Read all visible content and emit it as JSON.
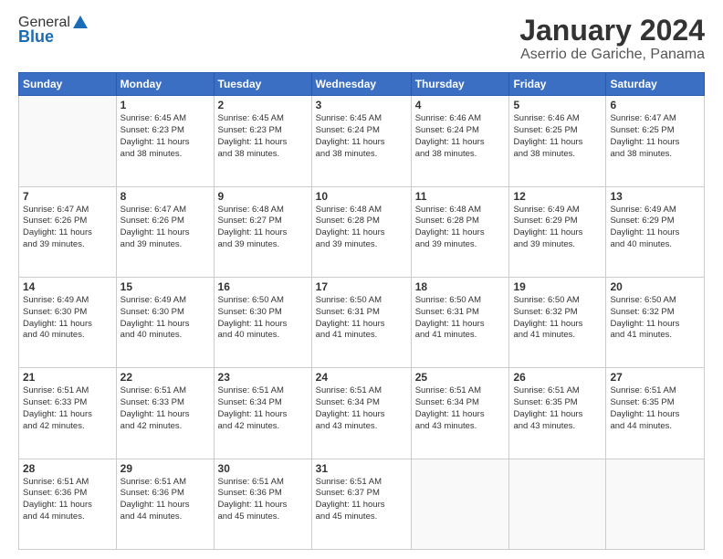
{
  "logo": {
    "line1": "General",
    "line2": "Blue"
  },
  "title": "January 2024",
  "subtitle": "Aserrio de Gariche, Panama",
  "days_header": [
    "Sunday",
    "Monday",
    "Tuesday",
    "Wednesday",
    "Thursday",
    "Friday",
    "Saturday"
  ],
  "weeks": [
    [
      {
        "day": "",
        "info": ""
      },
      {
        "day": "1",
        "info": "Sunrise: 6:45 AM\nSunset: 6:23 PM\nDaylight: 11 hours\nand 38 minutes."
      },
      {
        "day": "2",
        "info": "Sunrise: 6:45 AM\nSunset: 6:23 PM\nDaylight: 11 hours\nand 38 minutes."
      },
      {
        "day": "3",
        "info": "Sunrise: 6:45 AM\nSunset: 6:24 PM\nDaylight: 11 hours\nand 38 minutes."
      },
      {
        "day": "4",
        "info": "Sunrise: 6:46 AM\nSunset: 6:24 PM\nDaylight: 11 hours\nand 38 minutes."
      },
      {
        "day": "5",
        "info": "Sunrise: 6:46 AM\nSunset: 6:25 PM\nDaylight: 11 hours\nand 38 minutes."
      },
      {
        "day": "6",
        "info": "Sunrise: 6:47 AM\nSunset: 6:25 PM\nDaylight: 11 hours\nand 38 minutes."
      }
    ],
    [
      {
        "day": "7",
        "info": "Sunrise: 6:47 AM\nSunset: 6:26 PM\nDaylight: 11 hours\nand 39 minutes."
      },
      {
        "day": "8",
        "info": "Sunrise: 6:47 AM\nSunset: 6:26 PM\nDaylight: 11 hours\nand 39 minutes."
      },
      {
        "day": "9",
        "info": "Sunrise: 6:48 AM\nSunset: 6:27 PM\nDaylight: 11 hours\nand 39 minutes."
      },
      {
        "day": "10",
        "info": "Sunrise: 6:48 AM\nSunset: 6:28 PM\nDaylight: 11 hours\nand 39 minutes."
      },
      {
        "day": "11",
        "info": "Sunrise: 6:48 AM\nSunset: 6:28 PM\nDaylight: 11 hours\nand 39 minutes."
      },
      {
        "day": "12",
        "info": "Sunrise: 6:49 AM\nSunset: 6:29 PM\nDaylight: 11 hours\nand 39 minutes."
      },
      {
        "day": "13",
        "info": "Sunrise: 6:49 AM\nSunset: 6:29 PM\nDaylight: 11 hours\nand 40 minutes."
      }
    ],
    [
      {
        "day": "14",
        "info": "Sunrise: 6:49 AM\nSunset: 6:30 PM\nDaylight: 11 hours\nand 40 minutes."
      },
      {
        "day": "15",
        "info": "Sunrise: 6:49 AM\nSunset: 6:30 PM\nDaylight: 11 hours\nand 40 minutes."
      },
      {
        "day": "16",
        "info": "Sunrise: 6:50 AM\nSunset: 6:30 PM\nDaylight: 11 hours\nand 40 minutes."
      },
      {
        "day": "17",
        "info": "Sunrise: 6:50 AM\nSunset: 6:31 PM\nDaylight: 11 hours\nand 41 minutes."
      },
      {
        "day": "18",
        "info": "Sunrise: 6:50 AM\nSunset: 6:31 PM\nDaylight: 11 hours\nand 41 minutes."
      },
      {
        "day": "19",
        "info": "Sunrise: 6:50 AM\nSunset: 6:32 PM\nDaylight: 11 hours\nand 41 minutes."
      },
      {
        "day": "20",
        "info": "Sunrise: 6:50 AM\nSunset: 6:32 PM\nDaylight: 11 hours\nand 41 minutes."
      }
    ],
    [
      {
        "day": "21",
        "info": "Sunrise: 6:51 AM\nSunset: 6:33 PM\nDaylight: 11 hours\nand 42 minutes."
      },
      {
        "day": "22",
        "info": "Sunrise: 6:51 AM\nSunset: 6:33 PM\nDaylight: 11 hours\nand 42 minutes."
      },
      {
        "day": "23",
        "info": "Sunrise: 6:51 AM\nSunset: 6:34 PM\nDaylight: 11 hours\nand 42 minutes."
      },
      {
        "day": "24",
        "info": "Sunrise: 6:51 AM\nSunset: 6:34 PM\nDaylight: 11 hours\nand 43 minutes."
      },
      {
        "day": "25",
        "info": "Sunrise: 6:51 AM\nSunset: 6:34 PM\nDaylight: 11 hours\nand 43 minutes."
      },
      {
        "day": "26",
        "info": "Sunrise: 6:51 AM\nSunset: 6:35 PM\nDaylight: 11 hours\nand 43 minutes."
      },
      {
        "day": "27",
        "info": "Sunrise: 6:51 AM\nSunset: 6:35 PM\nDaylight: 11 hours\nand 44 minutes."
      }
    ],
    [
      {
        "day": "28",
        "info": "Sunrise: 6:51 AM\nSunset: 6:36 PM\nDaylight: 11 hours\nand 44 minutes."
      },
      {
        "day": "29",
        "info": "Sunrise: 6:51 AM\nSunset: 6:36 PM\nDaylight: 11 hours\nand 44 minutes."
      },
      {
        "day": "30",
        "info": "Sunrise: 6:51 AM\nSunset: 6:36 PM\nDaylight: 11 hours\nand 45 minutes."
      },
      {
        "day": "31",
        "info": "Sunrise: 6:51 AM\nSunset: 6:37 PM\nDaylight: 11 hours\nand 45 minutes."
      },
      {
        "day": "",
        "info": ""
      },
      {
        "day": "",
        "info": ""
      },
      {
        "day": "",
        "info": ""
      }
    ]
  ]
}
